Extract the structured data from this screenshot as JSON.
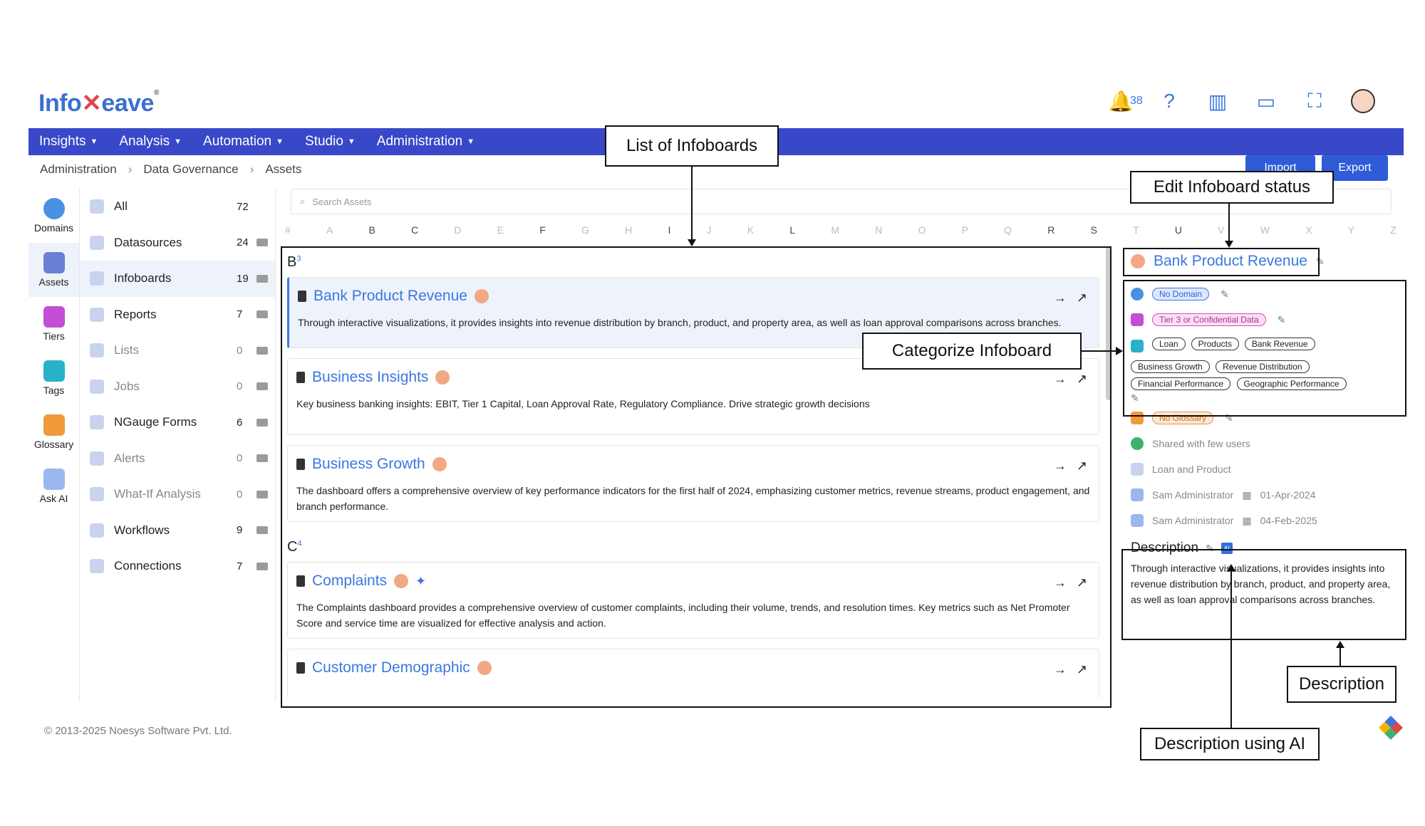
{
  "header": {
    "logo_a": "Info",
    "logo_b": "eave",
    "bell_count": "38"
  },
  "nav": [
    "Insights",
    "Analysis",
    "Automation",
    "Studio",
    "Administration"
  ],
  "breadcrumb": [
    "Administration",
    "Data Governance",
    "Assets"
  ],
  "buttons": {
    "import": "Import",
    "export": "Export"
  },
  "rail": [
    "Domains",
    "Assets",
    "Tiers",
    "Tags",
    "Glossary",
    "Ask AI"
  ],
  "categories": [
    {
      "label": "All",
      "count": "72"
    },
    {
      "label": "Datasources",
      "count": "24"
    },
    {
      "label": "Infoboards",
      "count": "19"
    },
    {
      "label": "Reports",
      "count": "7"
    },
    {
      "label": "Lists",
      "count": "0"
    },
    {
      "label": "Jobs",
      "count": "0"
    },
    {
      "label": "NGauge Forms",
      "count": "6"
    },
    {
      "label": "Alerts",
      "count": "0"
    },
    {
      "label": "What-If Analysis",
      "count": "0"
    },
    {
      "label": "Workflows",
      "count": "9"
    },
    {
      "label": "Connections",
      "count": "7"
    }
  ],
  "search": {
    "placeholder": "Search Assets"
  },
  "letters": [
    "#",
    "A",
    "B",
    "C",
    "D",
    "E",
    "F",
    "G",
    "H",
    "I",
    "J",
    "K",
    "L",
    "M",
    "N",
    "O",
    "P",
    "Q",
    "R",
    "S",
    "T",
    "U",
    "V",
    "W",
    "X",
    "Y",
    "Z"
  ],
  "list": {
    "group_b": "B",
    "group_b_count": "3",
    "group_c": "C",
    "group_c_count": "4",
    "items": [
      {
        "title": "Bank Product Revenue",
        "desc": "Through interactive visualizations, it provides insights into revenue distribution by branch, product, and property area, as well as loan approval comparisons across branches."
      },
      {
        "title": "Business Insights",
        "desc": "Key business banking insights: EBIT, Tier 1 Capital, Loan Approval Rate, Regulatory Compliance. Drive strategic growth decisions"
      },
      {
        "title": "Business Growth",
        "desc": "The dashboard offers a comprehensive overview of key performance indicators for the first half of 2024, emphasizing customer metrics, revenue streams, product engagement, and branch performance."
      },
      {
        "title": "Complaints",
        "desc": "The Complaints dashboard provides a comprehensive overview of customer complaints, including their volume, trends, and resolution times. Key metrics such as Net Promoter Score and service time are visualized for effective analysis and action."
      },
      {
        "title": "Customer Demographic",
        "desc": ""
      }
    ]
  },
  "details": {
    "title": "Bank Product Revenue",
    "domain": "No Domain",
    "tier": "Tier 3 or Confidential Data",
    "tags": [
      "Loan",
      "Products",
      "Bank Revenue",
      "Business Growth",
      "Revenue Distribution",
      "Financial Performance",
      "Geographic Performance"
    ],
    "glossary": "No Glossary",
    "shared": "Shared with few users",
    "folder": "Loan and Product",
    "created_by": "Sam Administrator",
    "created_on": "01-Apr-2024",
    "modified_by": "Sam Administrator",
    "modified_on": "04-Feb-2025",
    "desc_heading": "Description",
    "desc_text": "Through interactive visualizations, it provides insights into revenue distribution by branch, product, and property area, as well as loan approval comparisons across branches."
  },
  "footer": "© 2013-2025 Noesys Software Pvt. Ltd.",
  "annotations": {
    "list": "List of Infoboards",
    "status": "Edit Infoboard status",
    "categorize": "Categorize Infoboard",
    "description": "Description",
    "ai": "Description using AI"
  },
  "colors": {
    "nav": "#3848c9",
    "accent": "#3a78e0",
    "badge": "#f2a882"
  }
}
